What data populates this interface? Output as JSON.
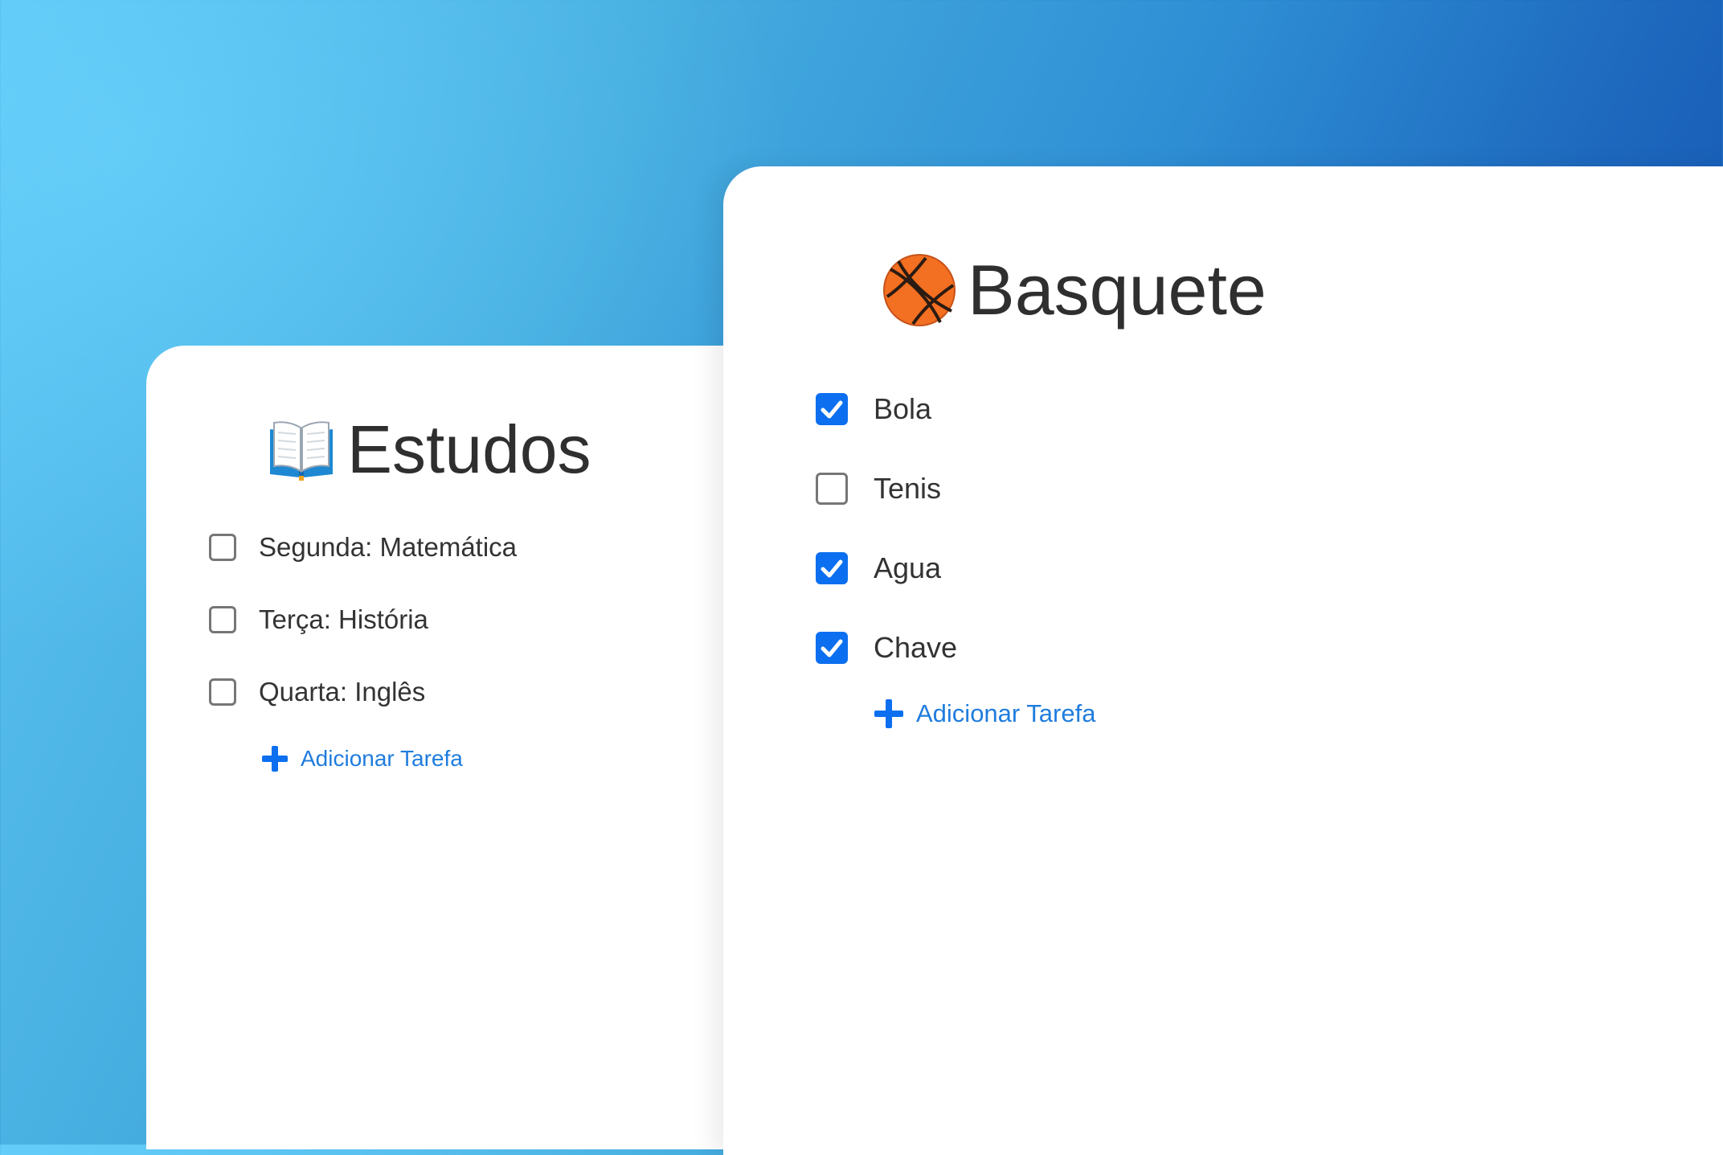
{
  "colors": {
    "accent": "#0b6ff0",
    "link": "#1f7cdd",
    "background_start": "#5ec6f4",
    "background_end": "#0c47a6"
  },
  "estudos": {
    "icon": "open-book-icon",
    "title": "Estudos",
    "tasks": [
      {
        "label": "Segunda: Matemática",
        "checked": false
      },
      {
        "label": "Terça: História",
        "checked": false
      },
      {
        "label": "Quarta: Inglês",
        "checked": false
      }
    ],
    "add_task_label": "Adicionar Tarefa"
  },
  "basquete": {
    "icon": "basketball-icon",
    "title": "Basquete",
    "tasks": [
      {
        "label": "Bola",
        "checked": true
      },
      {
        "label": "Tenis",
        "checked": false
      },
      {
        "label": "Agua",
        "checked": true
      },
      {
        "label": "Chave",
        "checked": true
      }
    ],
    "add_task_label": "Adicionar Tarefa"
  }
}
